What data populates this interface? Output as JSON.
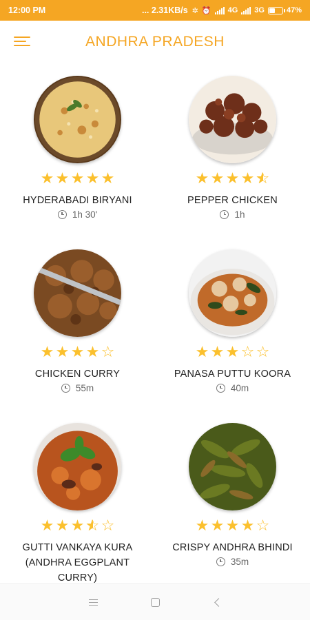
{
  "status_bar": {
    "time": "12:00 PM",
    "indicators": "... 2.31KB/s",
    "network_4g": "4G",
    "network_3g": "3G",
    "battery": "47%",
    "battery_level": 0.47
  },
  "header": {
    "title": "ANDHRA PRADESH",
    "menu_icon": "hamburger-menu-icon"
  },
  "colors": {
    "accent": "#f5a623",
    "star": "#fbc02d"
  },
  "recipes": [
    {
      "name": "HYDERABADI BIRYANI",
      "time": "1h 30'",
      "rating": 5
    },
    {
      "name": "PEPPER CHICKEN",
      "time": "1h",
      "rating": 4.5
    },
    {
      "name": "CHICKEN CURRY",
      "time": "55m",
      "rating": 4
    },
    {
      "name": "PANASA PUTTU KOORA",
      "time": "40m",
      "rating": 3
    },
    {
      "name": "GUTTI VANKAYA KURA (ANDHRA EGGPLANT CURRY)",
      "time": "",
      "rating": 3.5
    },
    {
      "name": "CRISPY ANDHRA BHINDI",
      "time": "35m",
      "rating": 4
    }
  ],
  "nav": {
    "menu_icon": "recent-apps-icon",
    "home_icon": "home-icon",
    "back_icon": "back-icon"
  }
}
